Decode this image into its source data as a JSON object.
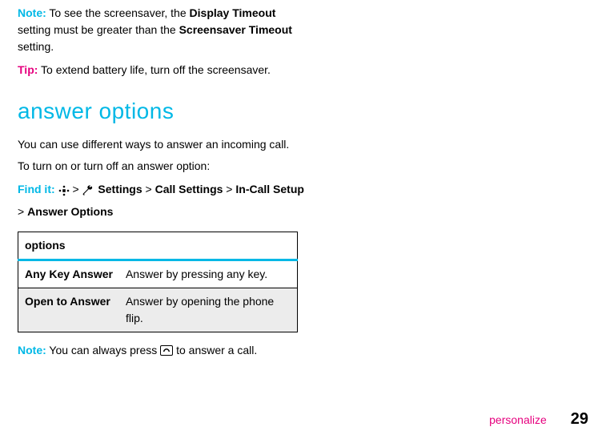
{
  "note1": {
    "label": "Note:",
    "pre": " To see the screensaver, the ",
    "bold1": "Display Timeout",
    "mid": " setting must be greater than the ",
    "bold2": "Screensaver Timeout",
    "post": " setting."
  },
  "tip": {
    "label": "Tip:",
    "text": " To extend battery life, turn off the screensaver."
  },
  "section_title": "answer options",
  "intro1": "You can use different ways to answer an incoming call.",
  "intro2": "To turn on or turn off an answer option:",
  "findit": {
    "label": "Find it:",
    "gt": ">",
    "settings": "Settings",
    "call_settings": "Call Settings",
    "incall": "In-Call Setup",
    "answer_options": "Answer Options"
  },
  "table": {
    "header": "options",
    "rows": [
      {
        "name": "Any Key Answer",
        "desc": "Answer by pressing any key."
      },
      {
        "name": "Open to Answer",
        "desc": "Answer by opening the phone flip."
      }
    ]
  },
  "note2": {
    "label": "Note:",
    "pre": " You can always press ",
    "post": " to answer a call."
  },
  "footer": {
    "section": "personalize",
    "page": "29"
  }
}
